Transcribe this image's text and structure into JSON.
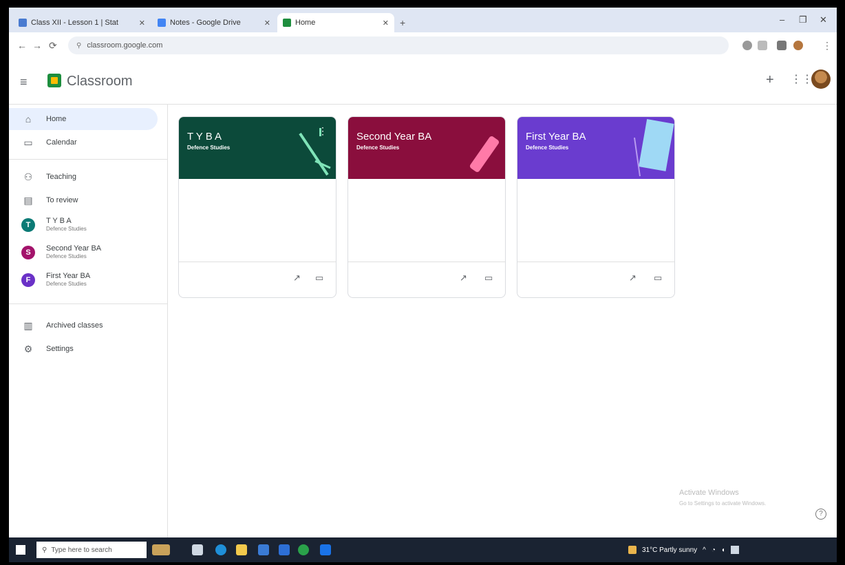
{
  "browser": {
    "tabs": [
      {
        "label": "Class XII - Lesson 1 | Stat",
        "favicon_color": "#4a7bd0"
      },
      {
        "label": "Notes - Google Drive",
        "favicon_color": "#4285f4"
      },
      {
        "label": "Home",
        "favicon_color": "#1e8e3e"
      }
    ],
    "address": "classroom.google.com"
  },
  "header": {
    "title": "Classroom"
  },
  "sidebar": {
    "items": [
      {
        "label": "Home",
        "icon": "home-icon"
      },
      {
        "label": "Calendar",
        "icon": "calendar-icon"
      },
      {
        "label": "Teaching",
        "icon": "people-icon"
      },
      {
        "label": "To review",
        "icon": "folder-icon"
      },
      {
        "label": "T Y B A",
        "sub": "Defence Studies",
        "initial": "T",
        "color": "#0b7a75"
      },
      {
        "label": "Second Year BA",
        "sub": "Defence Studies",
        "initial": "S",
        "color": "#a3136b"
      },
      {
        "label": "First Year BA",
        "sub": "Defence Studies",
        "initial": "F",
        "color": "#6a31c7"
      },
      {
        "label": "Archived classes",
        "icon": "archive-icon"
      },
      {
        "label": "Settings",
        "icon": "gear-icon"
      }
    ]
  },
  "cards": [
    {
      "title": "T Y B A",
      "subtitle": "Defence Studies",
      "color": "#0c4a3a"
    },
    {
      "title": "Second Year BA",
      "subtitle": "Defence Studies",
      "color": "#8a0e3d"
    },
    {
      "title": "First Year BA",
      "subtitle": "Defence Studies",
      "color": "#6a3ccf"
    }
  ],
  "watermark": {
    "line1": "Activate Windows",
    "line2": "Go to Settings to activate Windows."
  },
  "taskbar": {
    "search_placeholder": "Type here to search",
    "weather": "31°C Partly sunny"
  }
}
